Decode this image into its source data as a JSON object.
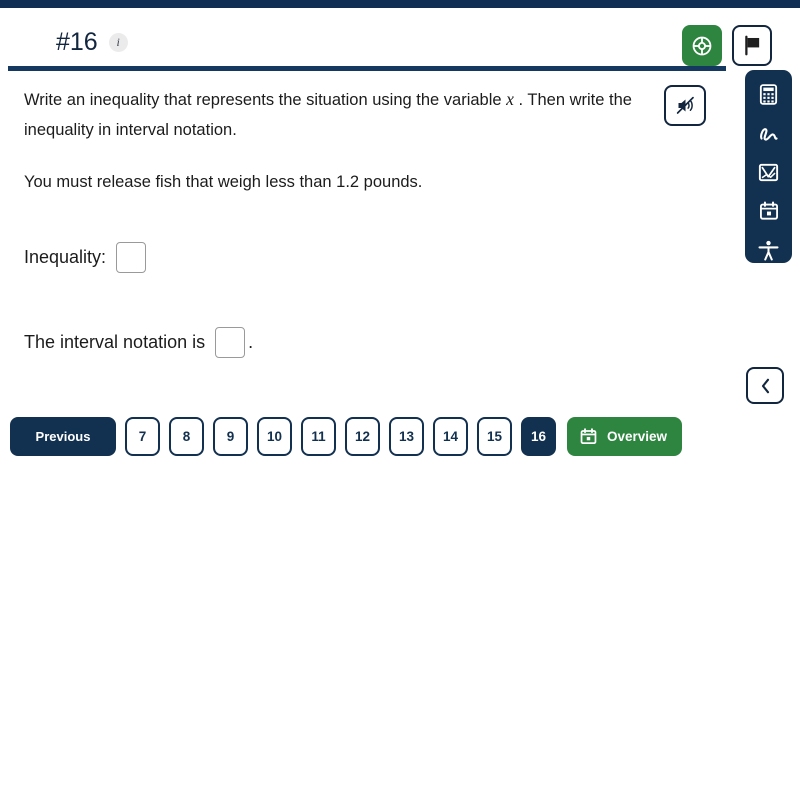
{
  "theme": {
    "navy": "#12304f",
    "navy_dark": "#102e53",
    "green": "#2e8540",
    "rule": "#14385f",
    "input_border": "#9a9a9a"
  },
  "header": {
    "question_number": "#16",
    "info_badge": "i",
    "help_button": {
      "name": "help-icon",
      "label": "Help"
    },
    "flag_button": {
      "name": "flag-icon",
      "label": "Flag question"
    }
  },
  "tool_dock": {
    "items": [
      {
        "icon": "calculator-icon",
        "label": "Calculator"
      },
      {
        "icon": "scribble-icon",
        "label": "Scratch work"
      },
      {
        "icon": "graph-icon",
        "label": "Graphing tool"
      },
      {
        "icon": "calendar-icon",
        "label": "Notepad"
      },
      {
        "icon": "accessibility-icon",
        "label": "Accessibility"
      }
    ],
    "collapse": {
      "icon": "chevron-left-icon",
      "label": "Collapse"
    }
  },
  "question": {
    "prompt_part_1": "Write an inequality that represents the situation using the variable",
    "variable": "x",
    "prompt_part_2": ". Then write the inequality in interval notation.",
    "situation": "You must release fish that weigh less than 1.2 pounds.",
    "audio_button": {
      "icon": "speaker-muted-icon",
      "label": "Read aloud"
    }
  },
  "answers": [
    {
      "id": "inequality",
      "label": "Inequality:",
      "value": "",
      "placeholder": "",
      "suffix": ""
    },
    {
      "id": "interval",
      "label": "The interval notation is",
      "value": "",
      "placeholder": "",
      "suffix": "."
    }
  ],
  "pagination": {
    "previous_label": "Previous",
    "pages": [
      "7",
      "8",
      "9",
      "10",
      "11",
      "12",
      "13",
      "14",
      "15",
      "16"
    ],
    "active_page": "16",
    "overview_label": "Overview",
    "overview_icon": "calendar-icon"
  }
}
